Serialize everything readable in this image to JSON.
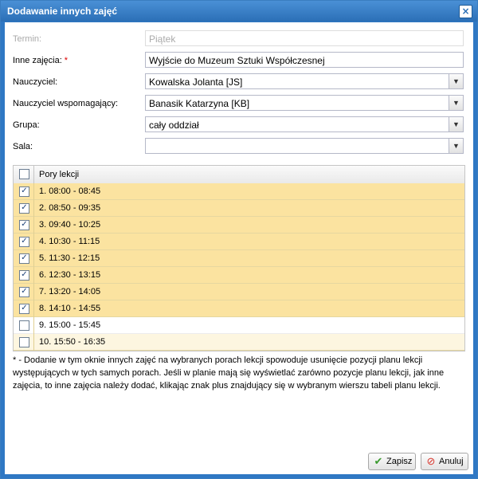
{
  "dialog": {
    "title": "Dodawanie innych zajęć",
    "close_glyph": "×"
  },
  "form": {
    "termin": {
      "label": "Termin:",
      "value": "Piątek"
    },
    "inne": {
      "label": "Inne zajęcia:",
      "required": "*",
      "value": "Wyjście do Muzeum Sztuki Współczesnej"
    },
    "nauczyciel": {
      "label": "Nauczyciel:",
      "value": "Kowalska Jolanta [JS]"
    },
    "wspomagajacy": {
      "label": "Nauczyciel wspomagający:",
      "value": "Banasik Katarzyna [KB]"
    },
    "grupa": {
      "label": "Grupa:",
      "value": "cały oddział"
    },
    "sala": {
      "label": "Sala:",
      "value": ""
    }
  },
  "grid": {
    "header": "Pory lekcji",
    "header_checked": false,
    "rows": [
      {
        "label": "1. 08:00 - 08:45",
        "checked": true
      },
      {
        "label": "2. 08:50 - 09:35",
        "checked": true
      },
      {
        "label": "3. 09:40 - 10:25",
        "checked": true
      },
      {
        "label": "4. 10:30 - 11:15",
        "checked": true
      },
      {
        "label": "5. 11:30 - 12:15",
        "checked": true
      },
      {
        "label": "6. 12:30 - 13:15",
        "checked": true
      },
      {
        "label": "7. 13:20 - 14:05",
        "checked": true
      },
      {
        "label": "8. 14:10 - 14:55",
        "checked": true
      },
      {
        "label": "9. 15:00 - 15:45",
        "checked": false
      },
      {
        "label": "10. 15:50 - 16:35",
        "checked": false
      }
    ]
  },
  "note": "* - Dodanie w tym oknie innych zajęć na wybranych porach lekcji spowoduje usunięcie pozycji planu lekcji występujących w tych samych porach. Jeśli w planie mają się wyświetlać zarówno pozycje planu lekcji, jak inne zajęcia, to inne zajęcia należy dodać, klikając znak plus znajdujący się w wybranym wierszu tabeli planu lekcji.",
  "buttons": {
    "save": {
      "label": "Zapisz",
      "icon": "checkmark-icon"
    },
    "cancel": {
      "label": "Anuluj",
      "icon": "cancel-icon"
    }
  },
  "colors": {
    "titlebar": "#2b6fb6",
    "selected_row": "#fbe3a0",
    "required": "#dd0000"
  }
}
